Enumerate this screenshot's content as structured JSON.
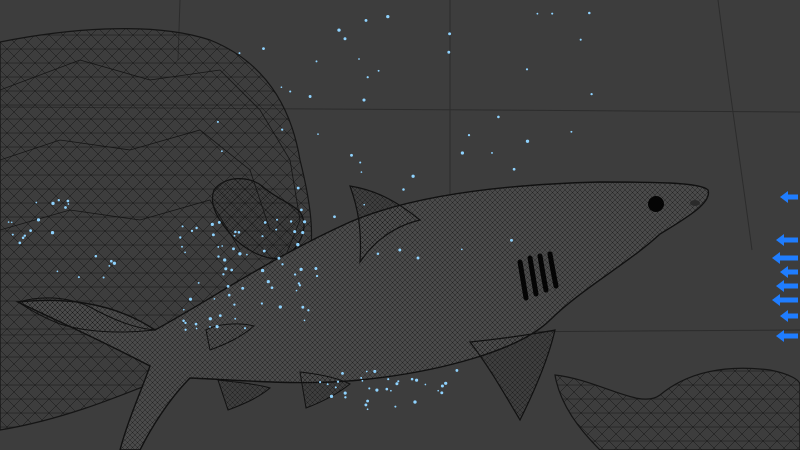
{
  "viewport": {
    "background": "#3d3d3d",
    "wire_color": "#111111",
    "grid_color": "#2c2c2c",
    "particle_color": "#8fd3ff",
    "gizmo_color": "#1f7dff"
  },
  "objects": [
    {
      "id": "shark",
      "icon": "shark-mesh-icon"
    },
    {
      "id": "coral-dome",
      "icon": "wire-dome-icon"
    },
    {
      "id": "rock",
      "icon": "rock-mesh-icon"
    },
    {
      "id": "seabed-rock",
      "icon": "wire-rock-icon"
    }
  ],
  "gizmo": {
    "arrow_count": 8,
    "icon": "arrow-left-icon"
  },
  "particles": {
    "count": 180
  }
}
